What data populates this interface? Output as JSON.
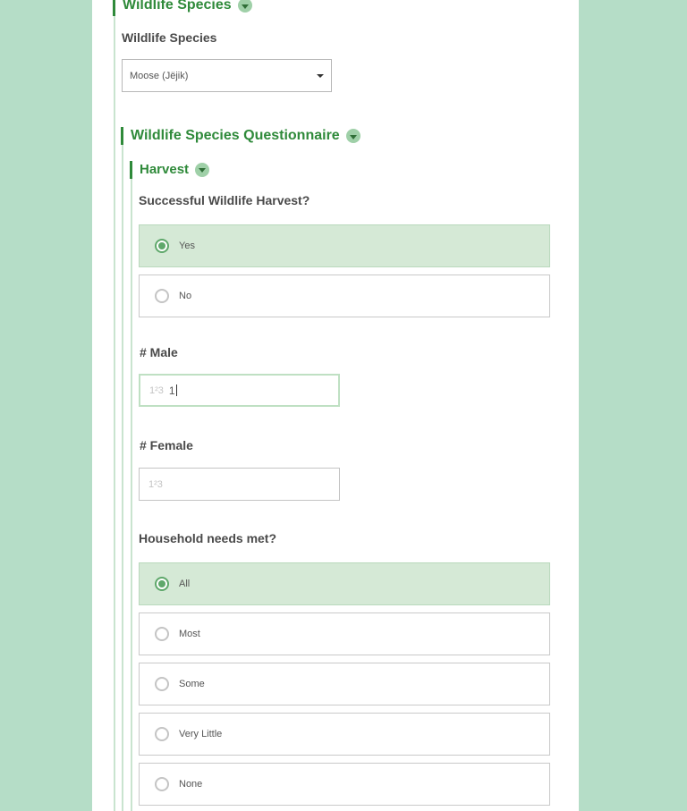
{
  "species_group": {
    "title": "Wildlife Species",
    "field_label": "Wildlife Species",
    "selected_value": "Moose (Jëjik)"
  },
  "questionnaire_group": {
    "title": "Wildlife Species Questionnaire"
  },
  "harvest_group": {
    "title": "Harvest",
    "successful_label": "Successful Wildlife Harvest?",
    "successful_options": [
      "Yes",
      "No"
    ],
    "successful_selected": "Yes",
    "male_label": "# Male",
    "male_value": "1",
    "female_label": "# Female",
    "female_value": "",
    "number_icon": "1²3",
    "needs_label": "Household needs met?",
    "needs_options": [
      "All",
      "Most",
      "Some",
      "Very Little",
      "None"
    ],
    "needs_selected": "All"
  },
  "colors": {
    "page_background": "#b5ddc7",
    "accent_green": "#2f8a3a",
    "selected_background": "#d5e9d6"
  }
}
